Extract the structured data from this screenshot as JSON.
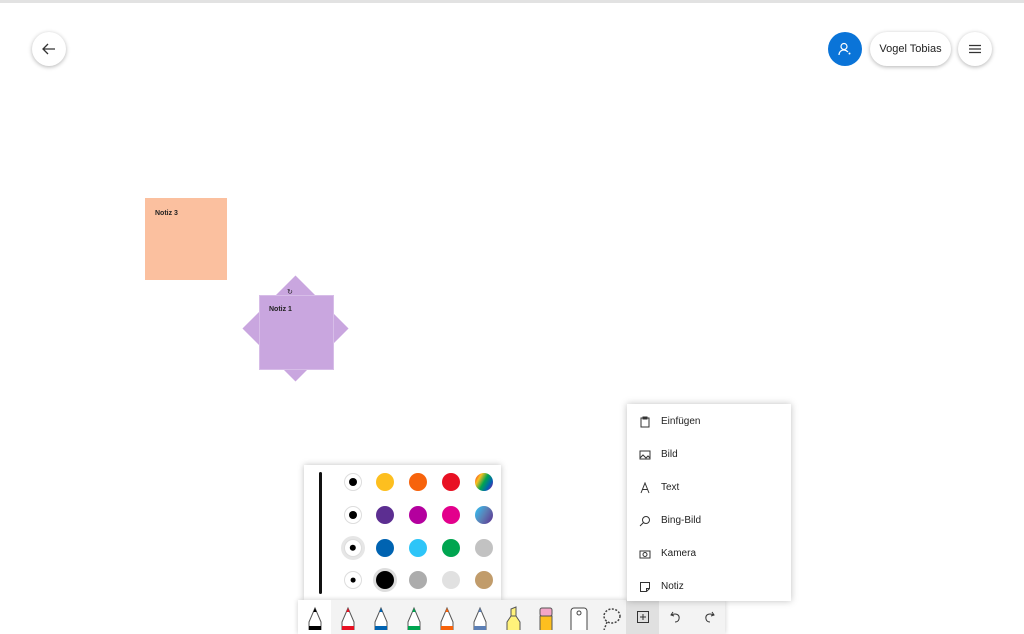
{
  "header": {
    "user_name": "Vogel Tobias"
  },
  "notes": [
    {
      "label": "Notiz 3",
      "color": "#fbc09f"
    },
    {
      "label": "Notiz 1",
      "color": "#c9a6df"
    }
  ],
  "pen_palette": {
    "sizes": [
      "large",
      "medium",
      "selected",
      "small"
    ],
    "colors": [
      [
        "#fdbf1f",
        "#f7630c",
        "#e81123",
        "rainbow"
      ],
      [
        "#5c2e91",
        "#b4009e",
        "#e3008c",
        "galaxy"
      ],
      [
        "#0063b1",
        "#2ec5f8",
        "#00a550",
        "#c2c2c2"
      ],
      [
        "#000000",
        "#acacac",
        "#e1e1e1",
        "#c19c6b"
      ]
    ],
    "selected_color": "#000000"
  },
  "toolbar": {
    "tools": [
      {
        "name": "ballpoint-pen-black",
        "color": "#000000"
      },
      {
        "name": "pen-red",
        "color": "#e81123"
      },
      {
        "name": "pen-blue",
        "color": "#0063b1"
      },
      {
        "name": "pen-green",
        "color": "#00a550"
      },
      {
        "name": "pen-rainbow",
        "color": "#f7630c"
      },
      {
        "name": "pen-galaxy",
        "color": "#5c7fb5"
      },
      {
        "name": "highlighter-yellow",
        "color": "#fff27a"
      },
      {
        "name": "eraser",
        "color": "#f4a6c8"
      },
      {
        "name": "ruler",
        "color": "#ffffff"
      },
      {
        "name": "lasso",
        "color": "#ffffff"
      }
    ]
  },
  "insert_menu": {
    "items": [
      {
        "label": "Einfügen",
        "icon": "paste-icon"
      },
      {
        "label": "Bild",
        "icon": "image-icon"
      },
      {
        "label": "Text",
        "icon": "text-icon"
      },
      {
        "label": "Bing-Bild",
        "icon": "search-icon"
      },
      {
        "label": "Kamera",
        "icon": "camera-icon"
      },
      {
        "label": "Notiz",
        "icon": "note-icon"
      }
    ]
  },
  "colors": {
    "accent": "#0a74d8"
  }
}
